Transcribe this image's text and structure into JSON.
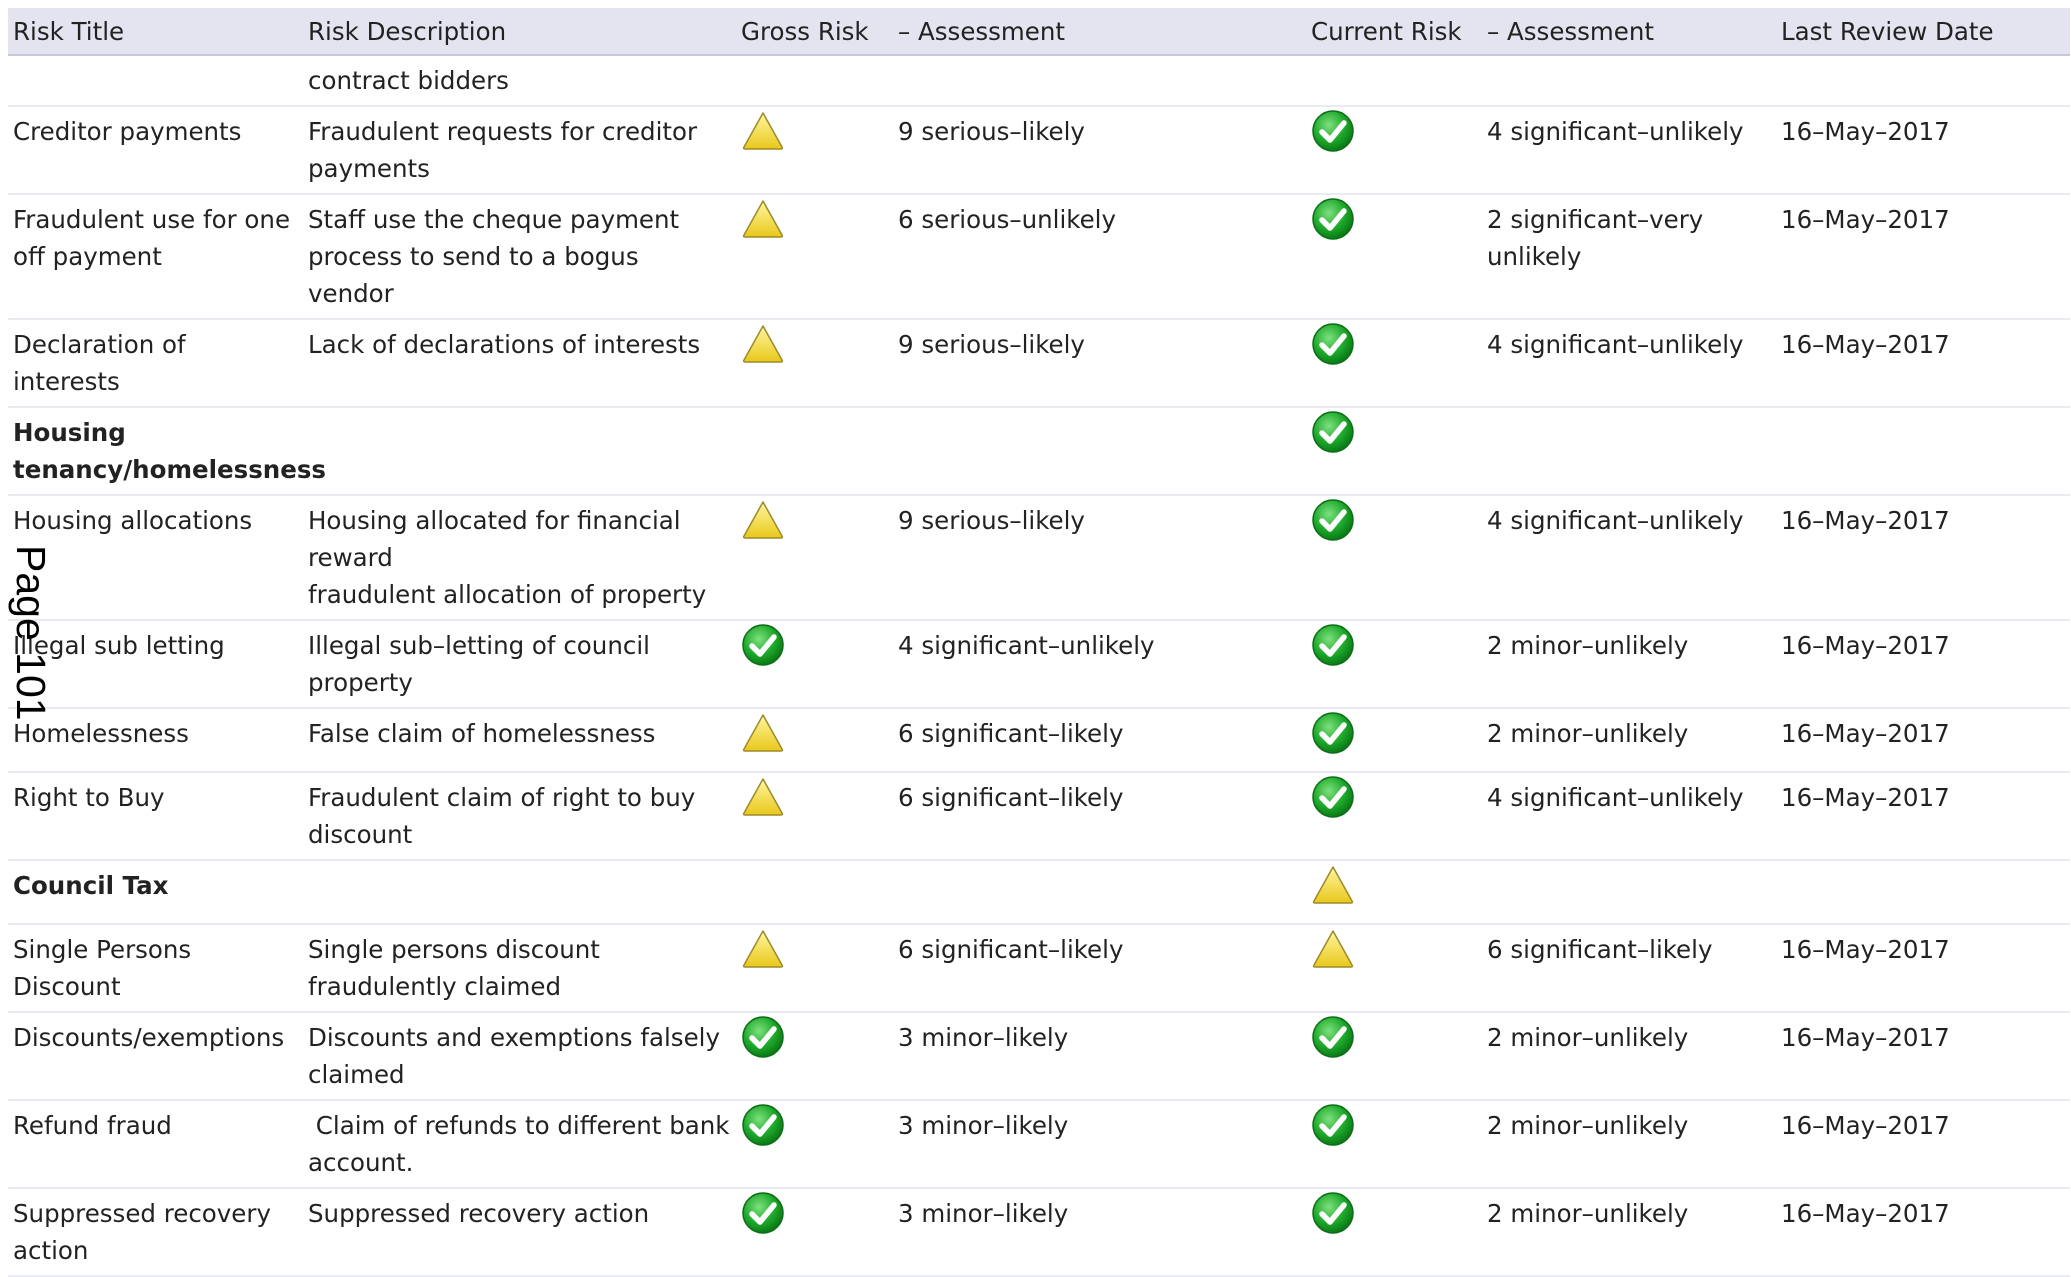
{
  "headers": {
    "risk_title": "Risk Title",
    "risk_description": "Risk Description",
    "gross_risk": "Gross Risk",
    "gross_assessment": "– Assessment",
    "current_risk": "Current Risk",
    "current_assessment": "– Assessment",
    "last_review_date": "Last Review Date"
  },
  "page_label": "Page 101",
  "rows": [
    {
      "title": "",
      "description": [
        "contract bidders"
      ],
      "gross_icon": "",
      "gross_assessment": "",
      "current_icon": "",
      "current_assessment": "",
      "date": ""
    },
    {
      "title": "Creditor payments",
      "description": [
        "Fraudulent requests for creditor payments"
      ],
      "gross_icon": "warning-triangle-icon",
      "gross_assessment": "9 serious–likely",
      "current_icon": "green-check-icon",
      "current_assessment": "4 significant–unlikely",
      "date": "16–May–2017"
    },
    {
      "title": "Fraudulent use for one off payment",
      "description": [
        "Staff use the cheque payment process to send to a bogus vendor"
      ],
      "gross_icon": "warning-triangle-icon",
      "gross_assessment": "6 serious–unlikely",
      "current_icon": "green-check-icon",
      "current_assessment": "2 significant–very unlikely",
      "date": "16–May–2017"
    },
    {
      "title": "Declaration of interests",
      "description": [
        "Lack of declarations of interests"
      ],
      "gross_icon": "warning-triangle-icon",
      "gross_assessment": "9 serious–likely",
      "current_icon": "green-check-icon",
      "current_assessment": "4 significant–unlikely",
      "date": "16–May–2017"
    },
    {
      "group": true,
      "title": "Housing tenancy/homelessness",
      "description": [],
      "gross_icon": "",
      "gross_assessment": "",
      "current_icon": "green-check-icon",
      "current_assessment": "",
      "date": ""
    },
    {
      "title": "Housing allocations",
      "description": [
        "Housing allocated for financial reward",
        "fraudulent allocation of property"
      ],
      "gross_icon": "warning-triangle-icon",
      "gross_assessment": "9 serious–likely",
      "current_icon": "green-check-icon",
      "current_assessment": "4 significant–unlikely",
      "date": "16–May–2017"
    },
    {
      "title": "Illegal sub letting",
      "description": [
        "Illegal sub–letting of council property"
      ],
      "gross_icon": "green-check-icon",
      "gross_assessment": "4 significant–unlikely",
      "current_icon": "green-check-icon",
      "current_assessment": "2 minor–unlikely",
      "date": "16–May–2017"
    },
    {
      "title": "Homelessness",
      "description": [
        "False claim of homelessness"
      ],
      "gross_icon": "warning-triangle-icon",
      "gross_assessment": "6 significant–likely",
      "current_icon": "green-check-icon",
      "current_assessment": "2 minor–unlikely",
      "date": "16–May–2017"
    },
    {
      "title": "Right to Buy",
      "description": [
        "Fraudulent claim of right to buy discount"
      ],
      "gross_icon": "warning-triangle-icon",
      "gross_assessment": "6 significant–likely",
      "current_icon": "green-check-icon",
      "current_assessment": "4 significant–unlikely",
      "date": "16–May–2017"
    },
    {
      "group": true,
      "title": "Council Tax",
      "description": [],
      "gross_icon": "",
      "gross_assessment": "",
      "current_icon": "warning-triangle-icon",
      "current_assessment": "",
      "date": ""
    },
    {
      "title": "Single Persons Discount",
      "description": [
        "Single persons discount fraudulently claimed"
      ],
      "gross_icon": "warning-triangle-icon",
      "gross_assessment": "6 significant–likely",
      "current_icon": "warning-triangle-icon",
      "current_assessment": "6 significant–likely",
      "date": "16–May–2017"
    },
    {
      "title": "Discounts/exemptions",
      "description": [
        "Discounts and exemptions falsely claimed"
      ],
      "gross_icon": "green-check-icon",
      "gross_assessment": "3 minor–likely",
      "current_icon": "green-check-icon",
      "current_assessment": "2 minor–unlikely",
      "date": "16–May–2017"
    },
    {
      "title": "Refund fraud",
      "description": [
        " Claim of refunds to different bank account."
      ],
      "gross_icon": "green-check-icon",
      "gross_assessment": "3 minor–likely",
      "current_icon": "green-check-icon",
      "current_assessment": "2 minor–unlikely",
      "date": "16–May–2017"
    },
    {
      "title": "Suppressed recovery action",
      "description": [
        "Suppressed recovery action"
      ],
      "gross_icon": "green-check-icon",
      "gross_assessment": "3 minor–likely",
      "current_icon": "green-check-icon",
      "current_assessment": "2 minor–unlikely",
      "date": "16–May–2017"
    }
  ]
}
